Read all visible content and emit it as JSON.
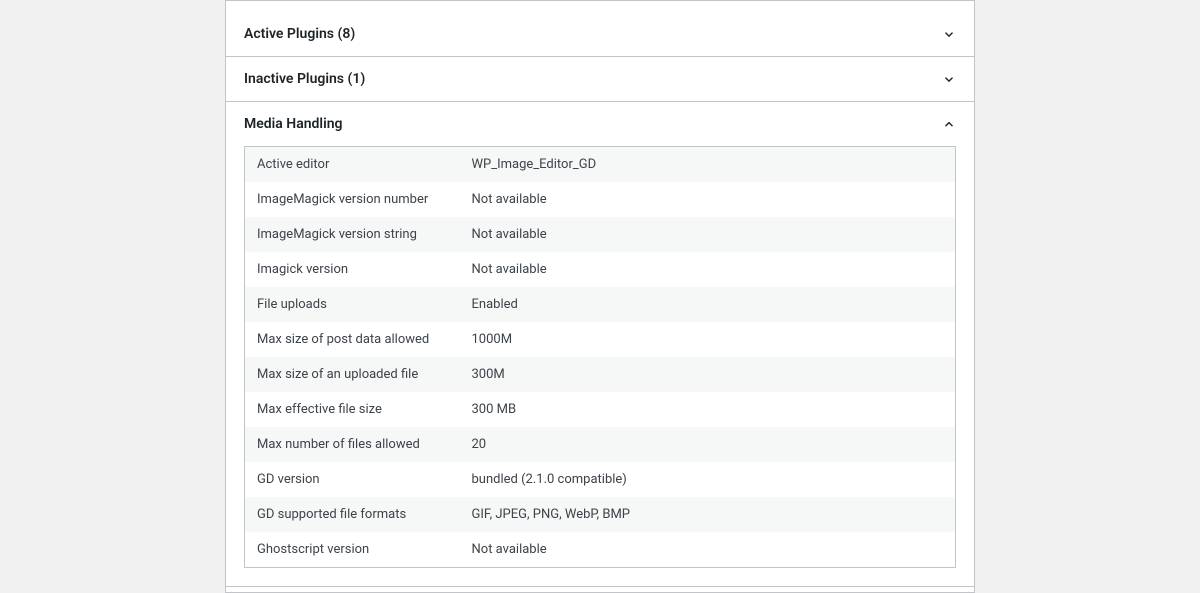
{
  "panels": {
    "active_plugins": {
      "title": "Active Plugins (8)",
      "expanded": false
    },
    "inactive_plugins": {
      "title": "Inactive Plugins (1)",
      "expanded": false
    },
    "media_handling": {
      "title": "Media Handling",
      "expanded": true,
      "rows": [
        {
          "label": "Active editor",
          "value": "WP_Image_Editor_GD"
        },
        {
          "label": "ImageMagick version number",
          "value": "Not available"
        },
        {
          "label": "ImageMagick version string",
          "value": "Not available"
        },
        {
          "label": "Imagick version",
          "value": "Not available"
        },
        {
          "label": "File uploads",
          "value": "Enabled"
        },
        {
          "label": "Max size of post data allowed",
          "value": "1000M"
        },
        {
          "label": "Max size of an uploaded file",
          "value": "300M"
        },
        {
          "label": "Max effective file size",
          "value": "300 MB"
        },
        {
          "label": "Max number of files allowed",
          "value": "20"
        },
        {
          "label": "GD version",
          "value": "bundled (2.1.0 compatible)"
        },
        {
          "label": "GD supported file formats",
          "value": "GIF, JPEG, PNG, WebP, BMP"
        },
        {
          "label": "Ghostscript version",
          "value": "Not available"
        }
      ]
    }
  }
}
